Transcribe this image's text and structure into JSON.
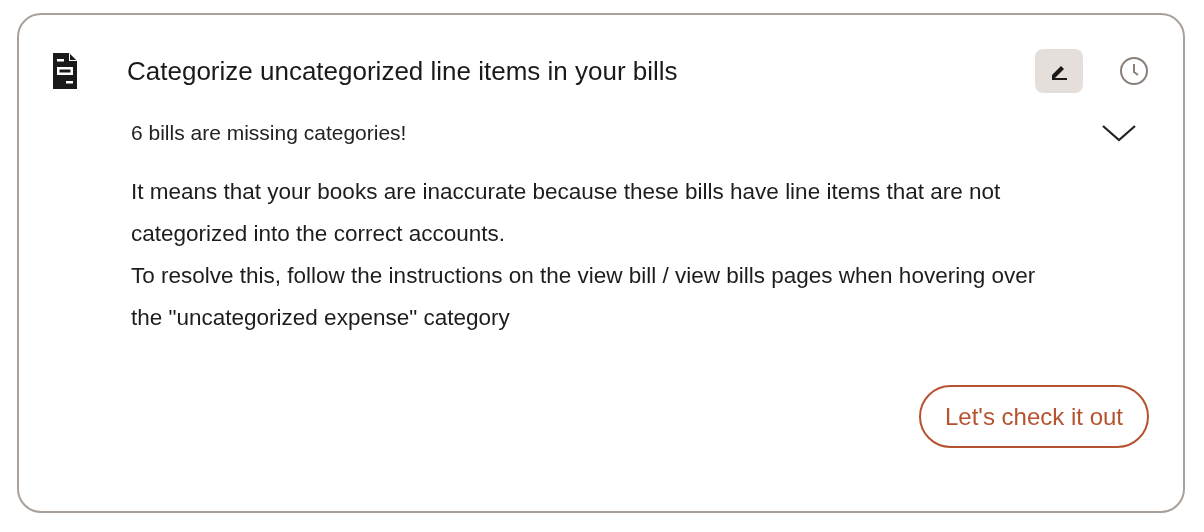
{
  "card": {
    "title": "Categorize uncategorized line items in your bills",
    "summary": "6 bills are missing categories!",
    "expanded": true,
    "paragraphs": [
      "It means that your books are inaccurate because these bills have line items that are not categorized into the correct accounts.",
      "To resolve this, follow the instructions on the view bill / view bills pages when hovering over the \"uncategorized expense\" category"
    ],
    "action": "Let's check it out"
  }
}
